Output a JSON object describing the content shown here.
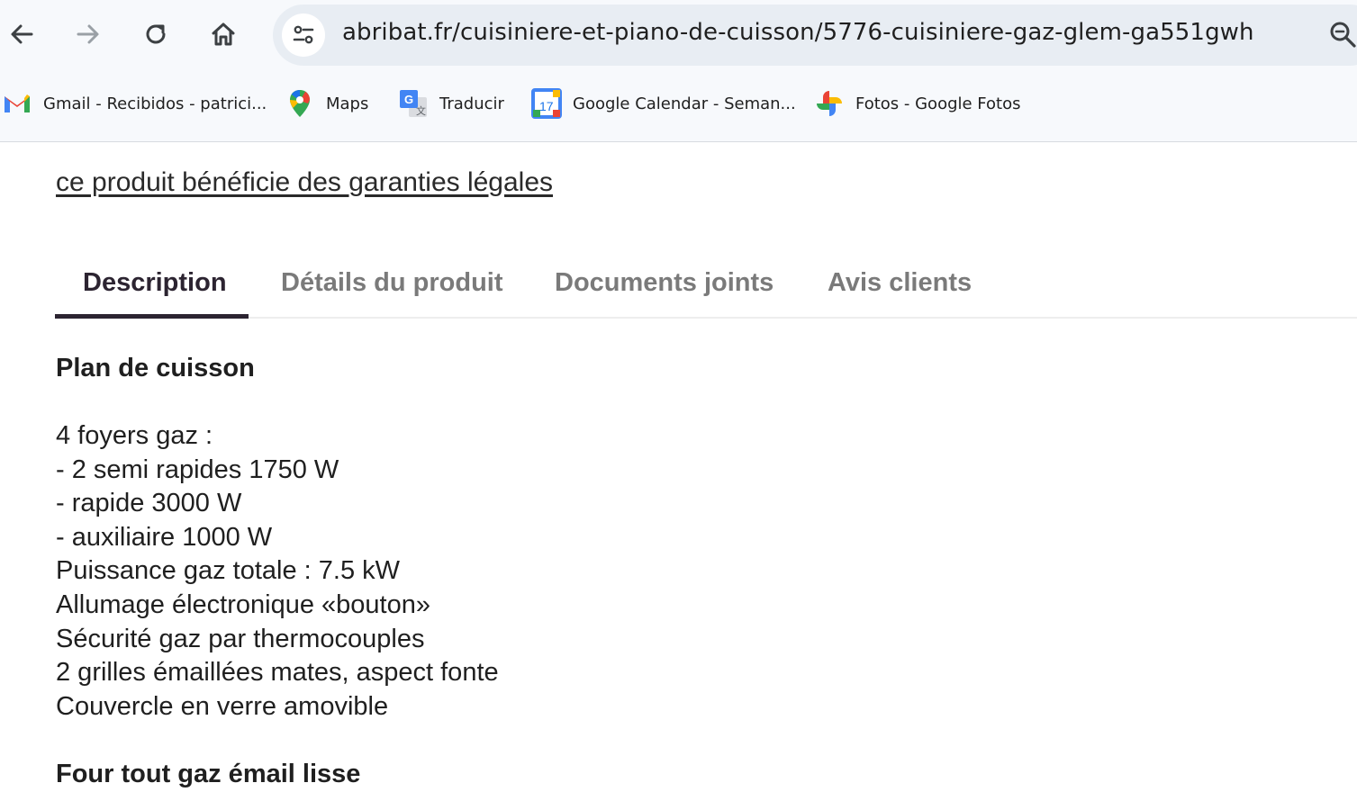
{
  "browser": {
    "url": "abribat.fr/cuisiniere-et-piano-de-cuisson/5776-cuisiniere-gaz-glem-ga551gwh",
    "bookmarks": [
      {
        "label": "Gmail - Recibidos - patrici...",
        "icon": "gmail-icon"
      },
      {
        "label": "Maps",
        "icon": "maps-icon"
      },
      {
        "label": "Traducir",
        "icon": "translate-icon"
      },
      {
        "label": "Google Calendar - Seman...",
        "icon": "calendar-icon"
      },
      {
        "label": "Fotos - Google Fotos",
        "icon": "photos-icon"
      }
    ],
    "calendar_day": "17"
  },
  "page": {
    "legal_link": "ce produit bénéficie des garanties légales",
    "tabs": [
      {
        "label": "Description",
        "active": true
      },
      {
        "label": "Détails du produit",
        "active": false
      },
      {
        "label": "Documents joints",
        "active": false
      },
      {
        "label": "Avis clients",
        "active": false
      }
    ],
    "section1_title": "Plan de cuisson",
    "section1_lines": [
      "4 foyers gaz :",
      "- 2 semi rapides 1750 W",
      "- rapide 3000 W",
      "- auxiliaire 1000 W",
      "Puissance gaz totale : 7.5 kW",
      "Allumage électronique «bouton»",
      "Sécurité gaz par thermocouples",
      "2 grilles émaillées mates, aspect fonte",
      "Couvercle en verre amovible"
    ],
    "section2_title": "Four tout gaz émail lisse"
  },
  "colors": {
    "chrome_bg": "#f7f9fc",
    "omnibox_bg": "#e8edf3",
    "tab_active": "#2c2431",
    "tab_inactive": "#7a7a7a"
  }
}
